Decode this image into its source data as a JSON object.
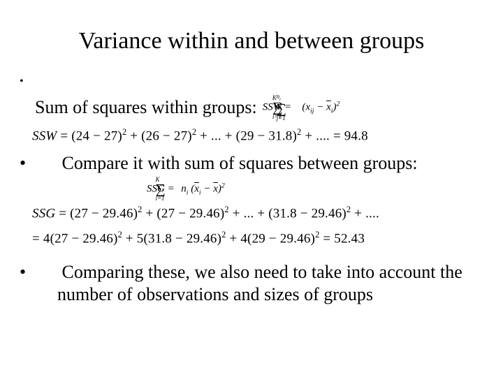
{
  "title": "Variance within and between groups",
  "bullets": {
    "b1": "Sum of squares within groups:",
    "b2": "Compare it with sum of squares between groups:",
    "b3": "Comparing these, we also need to take into account the number of observations and sizes of groups"
  },
  "formulas": {
    "ssw_def_lhs": "SSW",
    "ssw_def_sum_upper1": "K",
    "ssw_def_sum_lower1": "i=1",
    "ssw_def_sum_upper2": "n",
    "ssw_def_sum_upper2_sub": "i",
    "ssw_def_sum_lower2": "j=1",
    "ssw_def_term": "(x",
    "ssw_def_term_sub": "ij",
    "ssw_def_term2": " − x̄",
    "ssw_def_term2_sub": "i",
    "ssw_def_term3": ")",
    "ssw_example": "SSW = (24 − 27)² + (26 − 27)² + ... + (29 − 31.8)² + .... = 94.8",
    "ssg_def_lhs": "SSG",
    "ssg_def_sum_upper": "K",
    "ssg_def_sum_lower": "i=1",
    "ssg_def_n": "n",
    "ssg_def_n_sub": "i",
    "ssg_def_term": "(x̄",
    "ssg_def_term_sub": "i",
    "ssg_def_term2": " − x̄)",
    "ssg_line1": "SSG = (27 − 29.46)² + (27 − 29.46)² + ... + (31.8 − 29.46)² + ....",
    "ssg_line2": "= 4(27 − 29.46)² + 5(31.8 − 29.46)² + 4(29 − 29.46)² = 52.43"
  }
}
